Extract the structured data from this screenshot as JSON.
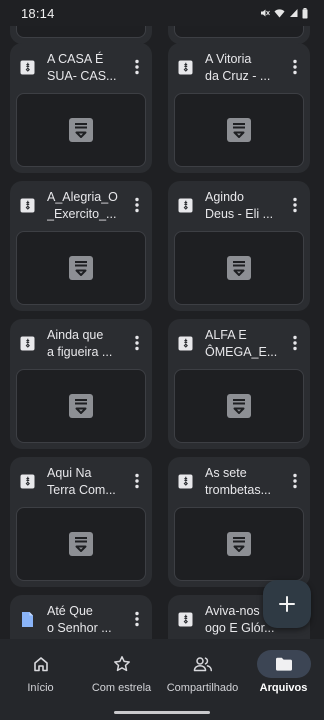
{
  "status_bar": {
    "time": "18:14",
    "icons": [
      "mute-icon",
      "wifi-icon",
      "signal-icon",
      "battery-icon"
    ]
  },
  "colors": {
    "background": "#1f2023",
    "card": "#2b2d31",
    "fab": "#2f3a44",
    "active_pill": "#3c4554"
  },
  "files": [
    {
      "line1": "",
      "line2": "",
      "icon": "drive-file-icon"
    },
    {
      "line1": "",
      "line2": "",
      "icon": "drive-file-icon"
    },
    {
      "line1": "A CASA É",
      "line2": "SUA- CAS...",
      "icon": "drive-file-icon"
    },
    {
      "line1": "A Vitoria",
      "line2": "da Cruz - ...",
      "icon": "drive-file-icon"
    },
    {
      "line1": "A_Alegria_O",
      "line2": "_Exercito_...",
      "icon": "drive-file-icon"
    },
    {
      "line1": "Agindo",
      "line2": "Deus - Eli ...",
      "icon": "drive-file-icon"
    },
    {
      "line1": "Ainda que",
      "line2": "a figueira ...",
      "icon": "drive-file-icon"
    },
    {
      "line1": "ALFA E",
      "line2": "ÔMEGA_E...",
      "icon": "drive-file-icon"
    },
    {
      "line1": "Aqui Na",
      "line2": "Terra Com...",
      "icon": "drive-file-icon"
    },
    {
      "line1": "As sete",
      "line2": "trombetas...",
      "icon": "drive-file-icon"
    },
    {
      "line1": "Até Que",
      "line2": "o Senhor ...",
      "icon": "docs-file-icon"
    },
    {
      "line1": "Aviva-nos",
      "line2": "ogo E Glór...",
      "icon": "drive-file-icon"
    }
  ],
  "fab": {
    "icon": "plus-icon"
  },
  "bottom_nav": [
    {
      "label": "Início",
      "icon": "home-icon",
      "active": false
    },
    {
      "label": "Com estrela",
      "icon": "star-icon",
      "active": false
    },
    {
      "label": "Compartilhado",
      "icon": "people-icon",
      "active": false
    },
    {
      "label": "Arquivos",
      "icon": "folder-icon",
      "active": true
    }
  ]
}
